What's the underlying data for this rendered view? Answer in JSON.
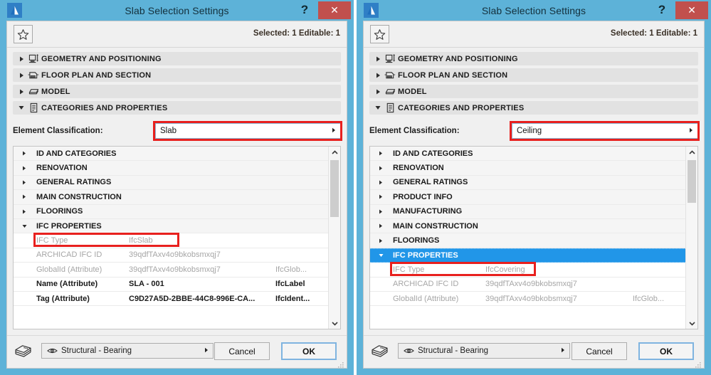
{
  "windows": [
    {
      "title": "Slab Selection Settings",
      "help_label": "?",
      "close_label": "✕",
      "selected_info": "Selected: 1 Editable: 1",
      "favorites_icon": "star-icon",
      "sections": [
        {
          "label": "GEOMETRY AND POSITIONING",
          "icon": "geometry-positioning-icon",
          "expanded": false
        },
        {
          "label": "FLOOR PLAN AND SECTION",
          "icon": "floor-plan-section-icon",
          "expanded": false
        },
        {
          "label": "MODEL",
          "icon": "model-icon",
          "expanded": false
        },
        {
          "label": "CATEGORIES AND PROPERTIES",
          "icon": "categories-properties-icon",
          "expanded": true
        }
      ],
      "classification": {
        "label": "Element Classification:",
        "value": "Slab",
        "highlighted": true
      },
      "property_rows": [
        {
          "kind": "group",
          "name": "ID AND CATEGORIES",
          "expanded": false,
          "selected": false
        },
        {
          "kind": "group",
          "name": "RENOVATION",
          "expanded": false,
          "selected": false
        },
        {
          "kind": "group",
          "name": "GENERAL RATINGS",
          "expanded": false,
          "selected": false
        },
        {
          "kind": "group",
          "name": "MAIN CONSTRUCTION",
          "expanded": false,
          "selected": false
        },
        {
          "kind": "group",
          "name": "FLOORINGS",
          "expanded": false,
          "selected": false
        },
        {
          "kind": "group",
          "name": "IFC PROPERTIES",
          "expanded": true,
          "selected": false
        },
        {
          "kind": "item",
          "style": "dim",
          "name": "IFC Type",
          "value": "IfcSlab",
          "type": ""
        },
        {
          "kind": "item",
          "style": "dim",
          "name": "ARCHICAD IFC ID",
          "value": "39qdfTAxv4o9bkobsmxqj7",
          "type": ""
        },
        {
          "kind": "item",
          "style": "dim",
          "name": "GlobalId (Attribute)",
          "value": "39qdfTAxv4o9bkobsmxqj7",
          "type": "IfcGlob..."
        },
        {
          "kind": "item",
          "style": "strong",
          "name": "Name (Attribute)",
          "value": "SLA - 001",
          "type": "IfcLabel"
        },
        {
          "kind": "item",
          "style": "strong",
          "name": "Tag (Attribute)",
          "value": "C9D27A5D-2BBE-44C8-996E-CA...",
          "type": "IfcIdent..."
        }
      ],
      "highlight_row_index": 6,
      "scroll": {
        "thumb_top_pct": 8,
        "thumb_height_pct": 42
      },
      "bottom": {
        "layer_icon": "layers-icon",
        "layer_visibility_icon": "eye-icon",
        "layer_value": "Structural - Bearing",
        "cancel_label": "Cancel",
        "ok_label": "OK"
      }
    },
    {
      "title": "Slab Selection Settings",
      "help_label": "?",
      "close_label": "✕",
      "selected_info": "Selected: 1 Editable: 1",
      "favorites_icon": "star-icon",
      "sections": [
        {
          "label": "GEOMETRY AND POSITIONING",
          "icon": "geometry-positioning-icon",
          "expanded": false
        },
        {
          "label": "FLOOR PLAN AND SECTION",
          "icon": "floor-plan-section-icon",
          "expanded": false
        },
        {
          "label": "MODEL",
          "icon": "model-icon",
          "expanded": false
        },
        {
          "label": "CATEGORIES AND PROPERTIES",
          "icon": "categories-properties-icon",
          "expanded": true
        }
      ],
      "classification": {
        "label": "Element Classification:",
        "value": "Ceiling",
        "highlighted": true
      },
      "property_rows": [
        {
          "kind": "group",
          "name": "ID AND CATEGORIES",
          "expanded": false,
          "selected": false
        },
        {
          "kind": "group",
          "name": "RENOVATION",
          "expanded": false,
          "selected": false
        },
        {
          "kind": "group",
          "name": "GENERAL RATINGS",
          "expanded": false,
          "selected": false
        },
        {
          "kind": "group",
          "name": "PRODUCT INFO",
          "expanded": false,
          "selected": false
        },
        {
          "kind": "group",
          "name": "MANUFACTURING",
          "expanded": false,
          "selected": false
        },
        {
          "kind": "group",
          "name": "MAIN CONSTRUCTION",
          "expanded": false,
          "selected": false
        },
        {
          "kind": "group",
          "name": "FLOORINGS",
          "expanded": false,
          "selected": false
        },
        {
          "kind": "group",
          "name": "IFC PROPERTIES",
          "expanded": true,
          "selected": true
        },
        {
          "kind": "item",
          "style": "dim",
          "name": "IFC Type",
          "value": "IfcCovering",
          "type": ""
        },
        {
          "kind": "item",
          "style": "dim",
          "name": "ARCHICAD IFC ID",
          "value": "39qdfTAxv4o9bkobsmxqj7",
          "type": ""
        },
        {
          "kind": "item",
          "style": "dim",
          "name": "GlobalId (Attribute)",
          "value": "39qdfTAxv4o9bkobsmxqj7",
          "type": "IfcGlob..."
        }
      ],
      "highlight_row_index": 8,
      "scroll": {
        "thumb_top_pct": 8,
        "thumb_height_pct": 42
      },
      "bottom": {
        "layer_icon": "layers-icon",
        "layer_visibility_icon": "eye-icon",
        "layer_value": "Structural - Bearing",
        "cancel_label": "Cancel",
        "ok_label": "OK"
      }
    }
  ],
  "colors": {
    "titlebar": "#5db2d8",
    "close_button": "#c1504d",
    "highlight_red": "#e8201e",
    "selection_blue": "#2196e8",
    "dialog_bg": "#f0f0f0"
  }
}
